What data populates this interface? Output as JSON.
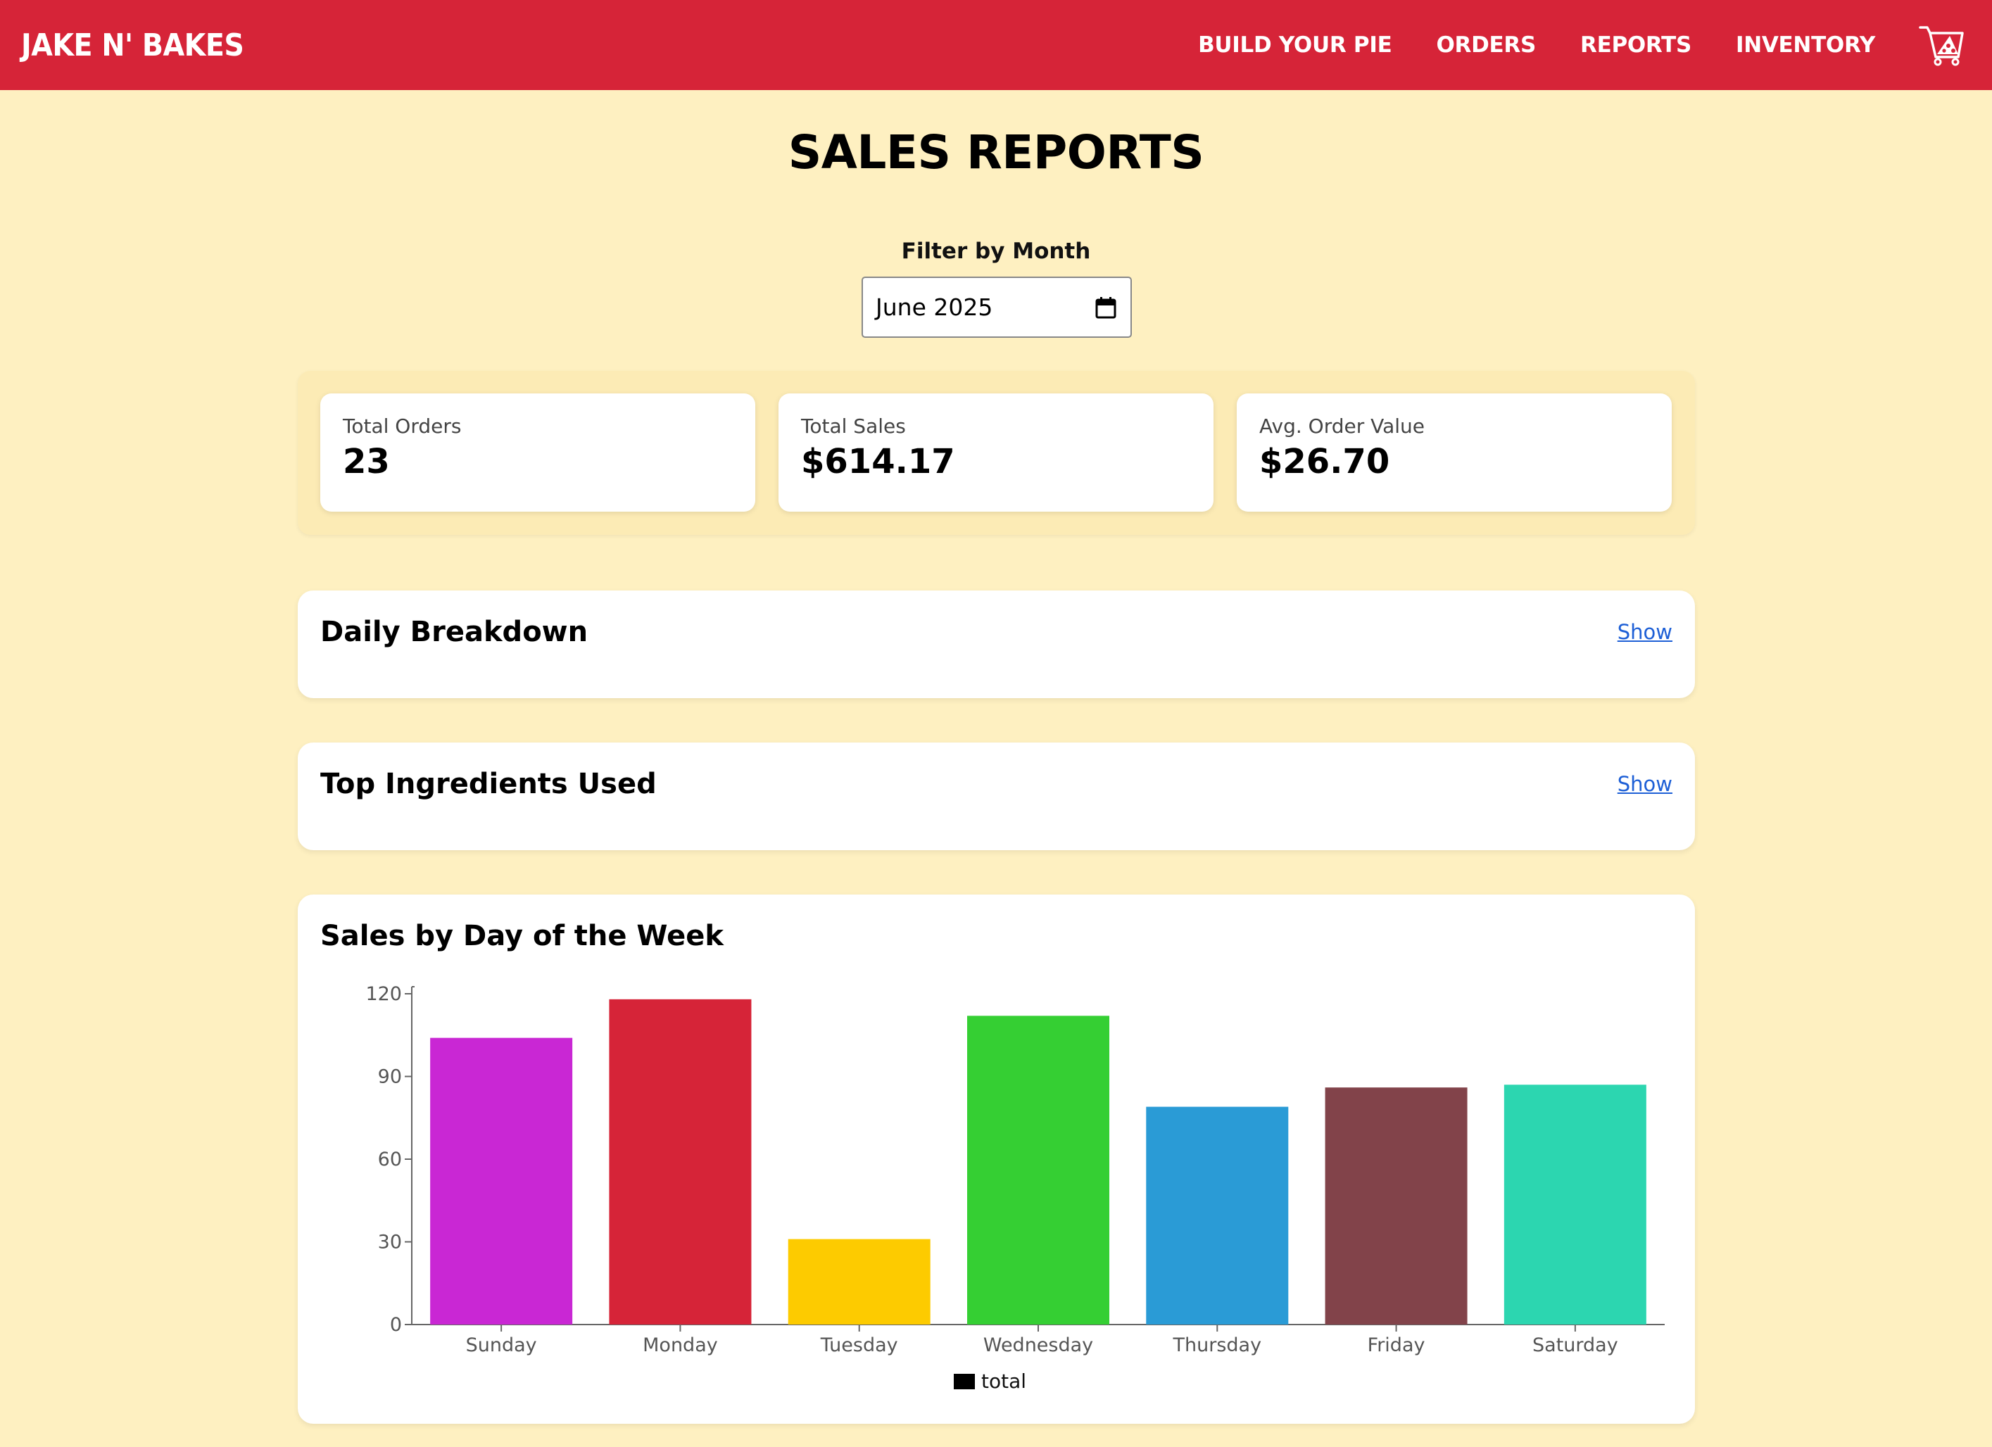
{
  "navbar": {
    "brand": "JAKE N' BAKES",
    "links": [
      "BUILD YOUR PIE",
      "ORDERS",
      "REPORTS",
      "INVENTORY"
    ]
  },
  "page": {
    "title": "SALES REPORTS",
    "filter_label": "Filter by Month",
    "month_value": "June 2025"
  },
  "stats": [
    {
      "label": "Total Orders",
      "value": "23"
    },
    {
      "label": "Total Sales",
      "value": "$614.17"
    },
    {
      "label": "Avg. Order Value",
      "value": "$26.70"
    }
  ],
  "sections": {
    "daily": {
      "title": "Daily Breakdown",
      "toggle": "Show"
    },
    "ingredients": {
      "title": "Top Ingredients Used",
      "toggle": "Show"
    },
    "weekly": {
      "title": "Sales by Day of the Week"
    }
  },
  "colors": {
    "navbar": "#d62438",
    "background": "#fef0c1",
    "link": "#1d5fd6"
  },
  "chart_data": {
    "type": "bar",
    "categories": [
      "Sunday",
      "Monday",
      "Tuesday",
      "Wednesday",
      "Thursday",
      "Friday",
      "Saturday"
    ],
    "series": [
      {
        "name": "total",
        "values": [
          104,
          118,
          31,
          112,
          79,
          86,
          87
        ]
      }
    ],
    "bar_colors": [
      "#c927d4",
      "#d62438",
      "#fdcb00",
      "#35cf33",
      "#2a9bd6",
      "#82434a",
      "#2cd6b0"
    ],
    "y_ticks": [
      0,
      30,
      60,
      90,
      120
    ],
    "ylim": [
      0,
      120
    ],
    "legend": [
      "total"
    ],
    "legend_position": "bottom"
  }
}
